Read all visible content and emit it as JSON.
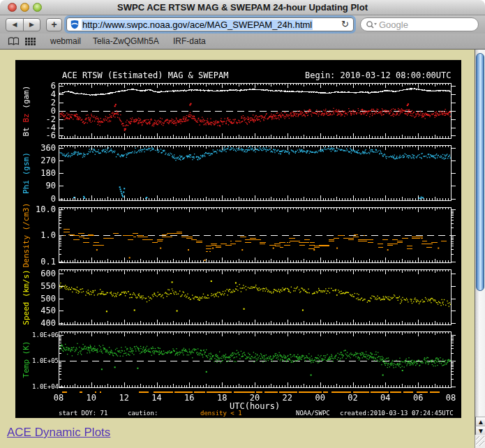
{
  "window": {
    "title": "SWPC ACE RTSW MAG & SWEPAM 24-hour Updating Plot"
  },
  "toolbar": {
    "back_glyph": "◀",
    "forward_glyph": "▶",
    "add_label": "+",
    "url": "http://www.swpc.noaa.gov/ace/MAG_SWEPAM_24h.html",
    "reload_glyph": "↻",
    "search_placeholder": "Google"
  },
  "bookmarks": {
    "items": [
      "webmail",
      "Telia-ZwQGMh5A",
      "IRF-data"
    ]
  },
  "page": {
    "link_text": "ACE Dynamic Plots",
    "background": "#DBD7A7",
    "link_color": "#5233B8"
  },
  "chart_data": {
    "type": "scatter",
    "title": "ACE RTSW (Estimated) MAG & SWEPAM",
    "begin_label": "Begin: 2010-03-12 08:00:00UTC",
    "xlabel": "UTC(hours)",
    "xticks": [
      "08",
      "10",
      "12",
      "14",
      "16",
      "18",
      "20",
      "22",
      "00",
      "02",
      "04",
      "06",
      "08"
    ],
    "footer": {
      "start_doy": "start DOY: 71",
      "caution_label": "caution:",
      "caution_value": "density < 1",
      "caution_color": "#FF9A00",
      "credit": "NOAA/SWPC",
      "created": "created:2010-03-13 07:24:45UTC"
    },
    "caution_segments": [
      [
        0.2,
        0.5
      ],
      [
        1.3,
        1.45
      ],
      [
        2.2,
        2.3
      ],
      [
        2.5,
        2.6
      ],
      [
        4.9,
        5.5
      ],
      [
        5.8,
        7.0
      ],
      [
        7.1,
        8.2
      ],
      [
        8.3,
        9.0
      ],
      [
        9.05,
        10.6
      ],
      [
        10.7,
        12.0
      ],
      [
        12.1,
        12.5
      ],
      [
        12.6,
        13.4
      ],
      [
        13.5,
        14.6
      ],
      [
        14.7,
        16.1
      ],
      [
        16.2,
        16.5
      ],
      [
        16.7,
        17.9
      ],
      [
        18.0,
        19.0
      ],
      [
        19.1,
        20.2
      ],
      [
        20.3,
        21.0
      ],
      [
        21.1,
        21.7
      ],
      [
        21.9,
        22.6
      ],
      [
        22.7,
        23.3
      ]
    ],
    "panels": [
      {
        "name": "mag",
        "label_parts": [
          {
            "text": "Bt",
            "color": "#FFFFFF"
          },
          {
            "text": "Bz",
            "color": "#FF2020"
          },
          {
            "text": "(gam)",
            "color": "#FFFFFF"
          }
        ],
        "scale": "linear",
        "ymin": -6.6,
        "ymax": 6.74,
        "yticks": [
          {
            "v": 6,
            "label": "6"
          },
          {
            "v": 4,
            "label": "4"
          },
          {
            "v": 2,
            "label": "2"
          },
          {
            "v": 0,
            "label": "0"
          },
          {
            "v": -2,
            "label": "-2"
          },
          {
            "v": -4,
            "label": "-4"
          },
          {
            "v": -6,
            "label": "-6"
          }
        ],
        "ref_line": 0,
        "series": [
          {
            "name": "Bt",
            "type": "line",
            "color": "#FFFFFF",
            "noise": 0.13,
            "step": 0.025,
            "skip": 0,
            "anchors": [
              4.3,
              4.8,
              4.3,
              4.15,
              3.9,
              4.1,
              4.25,
              4.7,
              5.0,
              5.3,
              5.0,
              5.2,
              4.6,
              4.8,
              4.9,
              5.0,
              5.1,
              5.1,
              5.0,
              4.9,
              5.0,
              5.1,
              5.05,
              5.2,
              5.3,
              5.15,
              5.0,
              4.9,
              4.8,
              4.75,
              4.7,
              4.65,
              4.5,
              4.35,
              4.7,
              4.6,
              4.5,
              4.6,
              4.55,
              4.6,
              5.0,
              4.75,
              5.1,
              5.45,
              5.3,
              5.0,
              4.9,
              5.0,
              4.85
            ],
            "outliers": []
          },
          {
            "name": "Bz",
            "type": "dots",
            "color": "#FF2020",
            "noise": 0.85,
            "step": 0.032,
            "skip": 0.05,
            "double": 0.35,
            "anchors": [
              -0.6,
              -1.6,
              -1.2,
              -2.1,
              -1.6,
              -2.4,
              -1.8,
              -0.4,
              -3.6,
              -2.2,
              -2.6,
              -2.4,
              -2.8,
              -2.4,
              -2.6,
              -2.2,
              -1.2,
              -2.4,
              -2.6,
              -2.8,
              -2.6,
              -2.4,
              -2.2,
              -2.0,
              -1.8,
              -1.5,
              -1.3,
              -1.1,
              -0.9,
              -0.6,
              -0.4,
              -0.3,
              -0.4,
              -0.2,
              -0.5,
              -0.3,
              -0.2,
              -0.3,
              -0.2,
              -0.1,
              -0.2,
              -0.3,
              0.2,
              -0.4,
              -0.6,
              -1.0,
              -0.7,
              -0.4,
              -0.3
            ],
            "outliers": [
              [
                3.4,
                1.3
              ],
              [
                3.45,
                1.7
              ],
              [
                8.0,
                1.6
              ],
              [
                8.05,
                1.9
              ],
              [
                21.3,
                1.5
              ],
              [
                21.35,
                1.8
              ],
              [
                4.0,
                -4.5
              ],
              [
                4.05,
                -4.2
              ]
            ]
          }
        ]
      },
      {
        "name": "phi",
        "label_parts": [
          {
            "text": "Phi (gsm)",
            "color": "#33CCFF"
          }
        ],
        "scale": "linear",
        "ymin": -12.3,
        "ymax": 377.3,
        "yticks": [
          {
            "v": 360,
            "label": "360"
          },
          {
            "v": 270,
            "label": "270"
          },
          {
            "v": 180,
            "label": "180"
          },
          {
            "v": 90,
            "label": "90"
          },
          {
            "v": 0,
            "label": "0"
          }
        ],
        "ref_line": null,
        "series": [
          {
            "name": "Phi",
            "type": "dots",
            "color": "#33CCFF",
            "noise": 17,
            "step": 0.038,
            "skip": 0.16,
            "double": 0.25,
            "anchors": [
              320,
              300,
              335,
              310,
              345,
              330,
              350,
              320,
              300,
              335,
              345,
              355,
              340,
              330,
              300,
              290,
              300,
              290,
              310,
              330,
              345,
              355,
              350,
              350,
              355,
              350,
              340,
              335,
              330,
              340,
              335,
              330,
              345,
              355,
              350,
              340,
              340,
              330,
              335,
              340,
              300,
              295,
              300,
              295,
              305,
              310,
              300,
              295,
              295
            ],
            "outliers": [
              [
                0.9,
                12
              ],
              [
                1.5,
                18
              ],
              [
                1.54,
                8
              ],
              [
                3.7,
                85
              ],
              [
                3.74,
                70
              ],
              [
                3.78,
                55
              ],
              [
                3.82,
                40
              ],
              [
                3.86,
                28
              ],
              [
                3.9,
                18
              ],
              [
                3.94,
                50
              ],
              [
                3.98,
                75
              ],
              [
                5.3,
                6
              ],
              [
                5.35,
                12
              ],
              [
                22.0,
                8
              ],
              [
                22.1,
                4
              ],
              [
                22.15,
                14
              ],
              [
                22.25,
                10
              ]
            ]
          }
        ]
      },
      {
        "name": "density",
        "label_parts": [
          {
            "text": "Density (/cm3)",
            "color": "#FF9A00"
          }
        ],
        "scale": "log",
        "ymin": 0.0939,
        "ymax": 12.02,
        "yticks": [
          {
            "v": 10,
            "label": "10.0"
          },
          {
            "v": 1,
            "label": "1.0"
          },
          {
            "v": 0.1,
            "label": "0.1"
          }
        ],
        "ref_line": 1,
        "series": [
          {
            "name": "Density",
            "type": "dashes",
            "color": "#FF9A00",
            "noise": 0.13,
            "step": 0.018,
            "skip": 0.12,
            "double": 0.55,
            "anchors": [
              1.05,
              1.1,
              1.2,
              1.0,
              0.9,
              0.42,
              0.9,
              1.1,
              1.0,
              1.05,
              0.9,
              0.7,
              0.65,
              1.2,
              1.3,
              1.1,
              0.8,
              0.55,
              0.5,
              0.6,
              0.55,
              0.45,
              0.5,
              0.65,
              0.7,
              0.6,
              0.55,
              0.5,
              0.6,
              0.7,
              0.65,
              0.5,
              0.45,
              0.55,
              0.8,
              0.9,
              0.95,
              0.9,
              0.7,
              0.6,
              0.65,
              0.6,
              0.55,
              0.6,
              0.7,
              0.65,
              0.6,
              0.55,
              0.6
            ],
            "outliers": [
              [
                2.3,
                0.3
              ],
              [
                4.3,
                0.15
              ],
              [
                6.2,
                0.35
              ],
              [
                7.9,
                0.3
              ],
              [
                8.9,
                0.12
              ],
              [
                9.4,
                0.35
              ],
              [
                11.2,
                0.3
              ],
              [
                13.1,
                0.35
              ],
              [
                15.6,
                0.3
              ],
              [
                17.0,
                0.35
              ],
              [
                20.1,
                0.3
              ],
              [
                23.2,
                0.35
              ]
            ]
          }
        ]
      },
      {
        "name": "speed",
        "label_parts": [
          {
            "text": "Speed (km/s)",
            "color": "#FFFF00"
          }
        ],
        "scale": "linear",
        "ymin": 394.4,
        "ymax": 616.9,
        "yticks": [
          {
            "v": 600,
            "label": "600"
          },
          {
            "v": 550,
            "label": "550"
          },
          {
            "v": 500,
            "label": "500"
          },
          {
            "v": 450,
            "label": "450"
          },
          {
            "v": 400,
            "label": "400"
          }
        ],
        "ref_line": null,
        "series": [
          {
            "name": "Speed",
            "type": "dots",
            "color": "#FFFF00",
            "noise": 14,
            "step": 0.048,
            "skip": 0.12,
            "double": 0.15,
            "anchors": [
              550,
              545,
              535,
              530,
              525,
              520,
              520,
              518,
              520,
              515,
              505,
              500,
              515,
              520,
              525,
              515,
              505,
              500,
              505,
              515,
              525,
              530,
              540,
              550,
              545,
              535,
              530,
              535,
              540,
              535,
              530,
              525,
              530,
              535,
              530,
              525,
              510,
              500,
              495,
              500,
              505,
              500,
              495,
              495,
              490,
              495,
              492,
              488,
              485
            ],
            "outliers": [
              [
                2.9,
                450
              ],
              [
                4.6,
                455
              ],
              [
                7.2,
                452
              ],
              [
                11.3,
                460
              ],
              [
                6.9,
                568
              ],
              [
                9.3,
                572
              ],
              [
                10.8,
                565
              ],
              [
                14.9,
                455
              ]
            ]
          }
        ]
      },
      {
        "name": "temp",
        "label_parts": [
          {
            "text": "Temp (K)",
            "color": "#2ECC2E"
          }
        ],
        "scale": "log",
        "ymin": 9500,
        "ymax": 1365000,
        "small_ticks": true,
        "yticks": [
          {
            "v": 1000000,
            "label": "1.0E+06"
          },
          {
            "v": 100000,
            "label": "1.0E+05"
          },
          {
            "v": 10000,
            "label": "1.0E+04"
          }
        ],
        "ref_line": 100000,
        "series": [
          {
            "name": "Temp",
            "type": "dots",
            "color": "#2ECC2E",
            "noise": 0.17,
            "step": 0.032,
            "skip": 0.1,
            "double": 0.3,
            "anchors": [
              320000,
              300000,
              280000,
              300000,
              320000,
              280000,
              240000,
              220000,
              240000,
              260000,
              280000,
              260000,
              240000,
              220000,
              200000,
              220000,
              240000,
              220000,
              180000,
              150000,
              130000,
              150000,
              170000,
              160000,
              140000,
              130000,
              150000,
              140000,
              120000,
              130000,
              140000,
              130000,
              120000,
              140000,
              160000,
              180000,
              170000,
              180000,
              160000,
              140000,
              90000,
              80000,
              85000,
              90000,
              85000,
              90000,
              95000,
              90000,
              100000
            ],
            "outliers": [
              [
                2.6,
                50000
              ],
              [
                3.4,
                60000
              ],
              [
                4.8,
                55000
              ],
              [
                9.0,
                40000
              ],
              [
                15.4,
                30000
              ],
              [
                19.8,
                30000
              ],
              [
                21.0,
                45000
              ]
            ]
          }
        ]
      }
    ]
  }
}
